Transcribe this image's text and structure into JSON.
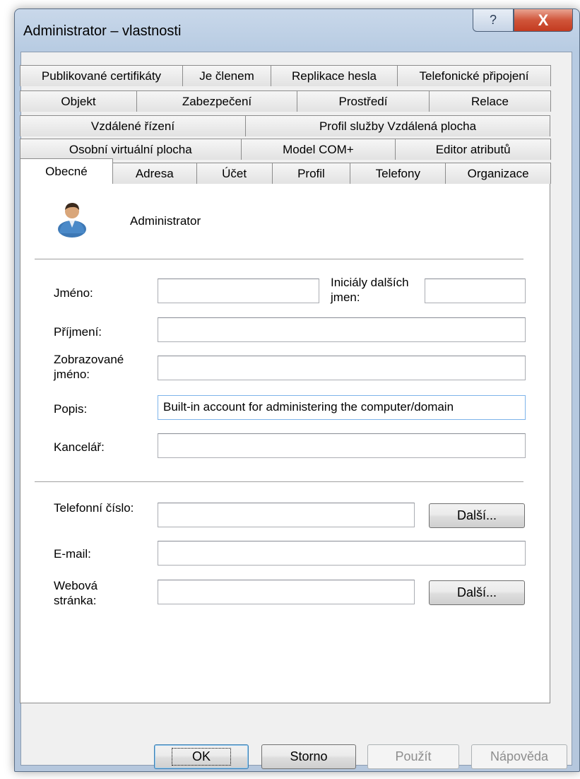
{
  "window": {
    "title": "Administrator – vlastnosti"
  },
  "caption_buttons": {
    "help": "?",
    "close": "X"
  },
  "tabs": {
    "row1": [
      "Publikované certifikáty",
      "Je členem",
      "Replikace hesla",
      "Telefonické připojení"
    ],
    "row2": [
      "Objekt",
      "Zabezpečení",
      "Prostředí",
      "Relace"
    ],
    "row3": [
      "Vzdálené řízení",
      "Profil služby Vzdálená plocha"
    ],
    "row4": [
      "Osobní virtuální plocha",
      "Model COM+",
      "Editor atributů"
    ],
    "row5": [
      "Obecné",
      "Adresa",
      "Účet",
      "Profil",
      "Telefony",
      "Organizace"
    ],
    "active": "Obecné"
  },
  "general": {
    "user_name": "Administrator",
    "jmeno_label": "Jméno:",
    "jmeno_value": "",
    "inicialy_label": "Iniciály dalších jmen:",
    "inicialy_value": "",
    "prijmeni_label": "Příjmení:",
    "prijmeni_value": "",
    "zobrazovane_label": "Zobrazované jméno:",
    "zobrazovane_value": "",
    "popis_label": "Popis:",
    "popis_value": "Built-in account for administering the computer/domain",
    "kancelar_label": "Kancelář:",
    "kancelar_value": "",
    "telefon_label": "Telefonní číslo:",
    "telefon_value": "",
    "telefon_more": "Další...",
    "email_label": "E-mail:",
    "email_value": "",
    "web_label": "Webová stránka:",
    "web_value": "",
    "web_more": "Další..."
  },
  "footer": {
    "ok": "OK",
    "storno": "Storno",
    "pouzit": "Použít",
    "napoveda": "Nápověda"
  }
}
